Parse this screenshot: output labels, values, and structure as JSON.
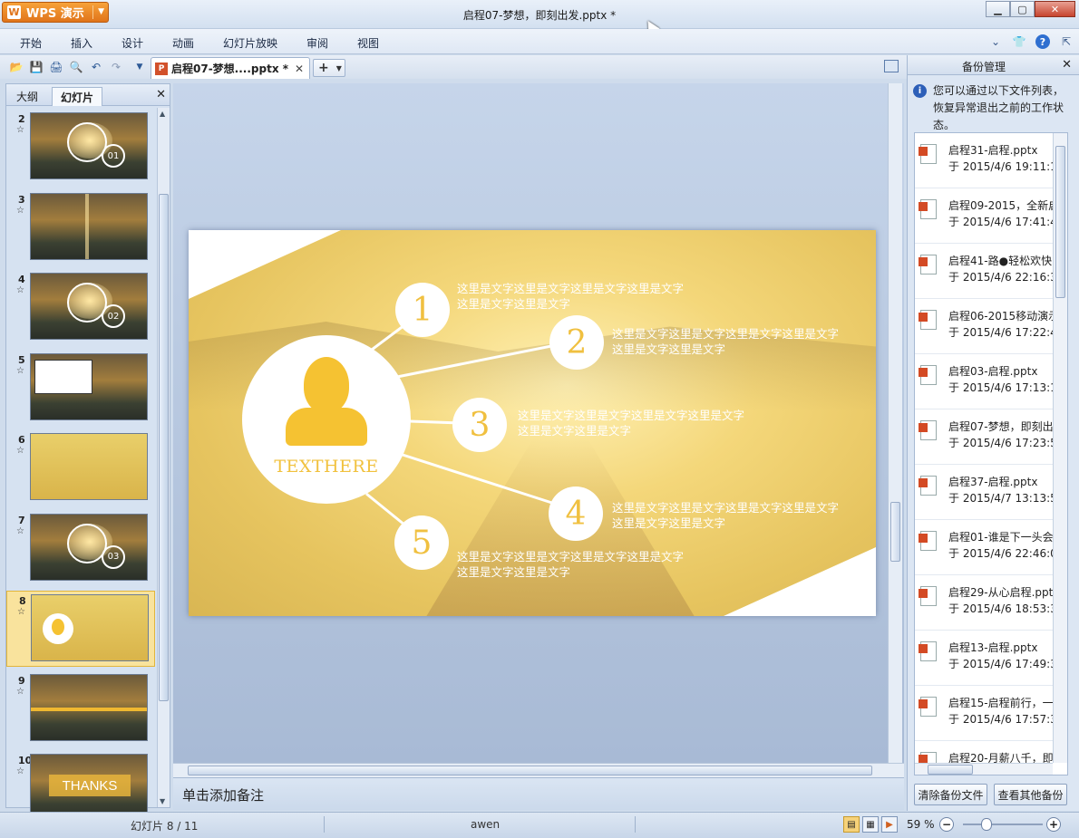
{
  "app": {
    "button_label": "WPS 演示",
    "logo_glyph": "W"
  },
  "window": {
    "title": "启程07-梦想，即刻出发.pptx *"
  },
  "menu": {
    "items": [
      "开始",
      "插入",
      "设计",
      "动画",
      "幻灯片放映",
      "审阅",
      "视图"
    ]
  },
  "toolbar": {
    "doc_tab_label": "启程07-梦想....pptx *",
    "new_tab": "+"
  },
  "left_panel": {
    "tabs": [
      "大纲",
      "幻灯片"
    ],
    "active_tab": "幻灯片",
    "slides": [
      {
        "num": "2",
        "style": "bulb",
        "badge": "01"
      },
      {
        "num": "3",
        "style": "list",
        "badge": ""
      },
      {
        "num": "4",
        "style": "bulb",
        "badge": "02"
      },
      {
        "num": "5",
        "style": "box",
        "badge": ""
      },
      {
        "num": "6",
        "style": "swot",
        "badge": ""
      },
      {
        "num": "7",
        "style": "bulb",
        "badge": "03"
      },
      {
        "num": "8",
        "style": "current",
        "badge": ""
      },
      {
        "num": "9",
        "style": "timeline",
        "badge": ""
      },
      {
        "num": "10",
        "style": "thanks",
        "badge": "THANKS"
      }
    ],
    "selected_slide": "8"
  },
  "slide": {
    "center_label": "TEXTHERE",
    "nodes": [
      {
        "num": "1",
        "text": "这里是文字这里是文字这里是文字这里是文字这里是文字这里是文字"
      },
      {
        "num": "2",
        "text": "这里是文字这里是文字这里是文字这里是文字这里是文字这里是文字"
      },
      {
        "num": "3",
        "text": "这里是文字这里是文字这里是文字这里是文字这里是文字这里是文字"
      },
      {
        "num": "4",
        "text": "这里是文字这里是文字这里是文字这里是文字这里是文字这里是文字"
      },
      {
        "num": "5",
        "text": "这里是文字这里是文字这里是文字这里是文字这里是文字这里是文字"
      }
    ],
    "accent_color": "#f5c232"
  },
  "notes": {
    "placeholder": "单击添加备注"
  },
  "right_panel": {
    "title": "备份管理",
    "info_text": "您可以通过以下文件列表，恢复异常退出之前的工作状态。",
    "backups": [
      {
        "name": "启程31-启程.pptx",
        "date": "于 2015/4/6 19:11:1"
      },
      {
        "name": "启程09-2015，全新启",
        "date": "于 2015/4/6 17:41:4"
      },
      {
        "name": "启程41-路●轻松欢快",
        "date": "于 2015/4/6 22:16:3"
      },
      {
        "name": "启程06-2015移动演示",
        "date": "于 2015/4/6 17:22:4"
      },
      {
        "name": "启程03-启程.pptx",
        "date": "于 2015/4/6 17:13:1"
      },
      {
        "name": "启程07-梦想，即刻出",
        "date": "于 2015/4/6 17:23:5"
      },
      {
        "name": "启程37-启程.pptx",
        "date": "于 2015/4/7 13:13:5"
      },
      {
        "name": "启程01-谁是下一头会",
        "date": "于 2015/4/6 22:46:0"
      },
      {
        "name": "启程29-从心启程.pptx",
        "date": "于 2015/4/6 18:53:3"
      },
      {
        "name": "启程13-启程.pptx",
        "date": "于 2015/4/6 17:49:3"
      },
      {
        "name": "启程15-启程前行，一",
        "date": "于 2015/4/6 17:57:3"
      },
      {
        "name": "启程20-月薪八千，即",
        "date": ""
      }
    ],
    "clear_button": "清除备份文件",
    "view_other_button": "查看其他备份"
  },
  "status": {
    "slide_indicator": "幻灯片 8 / 11",
    "author": "awen",
    "zoom": "59 %",
    "zoom_fraction": 0.3
  }
}
